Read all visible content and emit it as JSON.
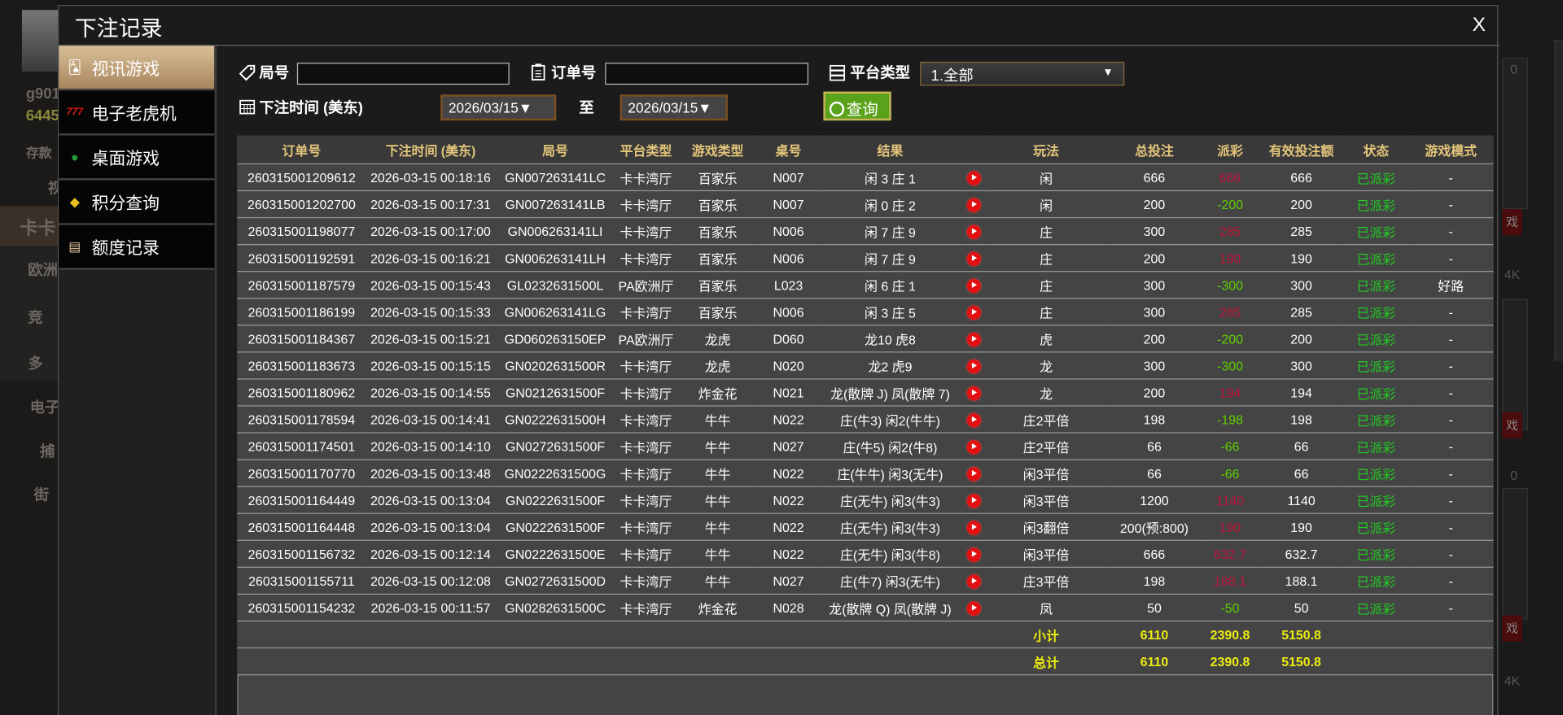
{
  "background": {
    "left_fragments": [
      "g901",
      "6445",
      "存款",
      "视",
      "卡卡",
      "欧洲",
      "竞",
      "多",
      "电子",
      "捕",
      "街"
    ],
    "right_fragments": [
      "0",
      "4K",
      "戏",
      "0",
      "4K"
    ]
  },
  "modal": {
    "title": "下注记录",
    "close_label": "X"
  },
  "menu": [
    {
      "label": "视讯游戏",
      "icon": "playing-cards-icon",
      "active": true
    },
    {
      "label": "电子老虎机",
      "icon": "slot-777-icon",
      "active": false
    },
    {
      "label": "桌面游戏",
      "icon": "chips-icon",
      "active": false
    },
    {
      "label": "积分查询",
      "icon": "diamond-icon",
      "active": false
    },
    {
      "label": "额度记录",
      "icon": "document-icon",
      "active": false
    }
  ],
  "filters": {
    "round_label": "局号",
    "round_value": "",
    "order_label": "订单号",
    "order_value": "",
    "platform_label": "平台类型",
    "platform_value": "1.全部",
    "time_label": "下注时间 (美东)",
    "date_from": "2026/03/15▼",
    "to_label": "至",
    "date_to": "2026/03/15▼",
    "query_label": "查询"
  },
  "colors": {
    "positive_payout": "#c0143c",
    "negative_payout": "#5fd000",
    "status": "#22cc22",
    "header": "#e2c47a",
    "totals": "#ecec10",
    "query_button": "#5aa21a"
  },
  "table": {
    "headers": [
      "订单号",
      "下注时间 (美东)",
      "局号",
      "平台类型",
      "游戏类型",
      "桌号",
      "结果",
      "",
      "玩法",
      "总投注",
      "派彩",
      "有效投注额",
      "状态",
      "游戏模式"
    ],
    "rows": [
      [
        "260315001209612",
        "2026-03-15 00:18:16",
        "GN007263141LC",
        "卡卡湾厅",
        "百家乐",
        "N007",
        "闲 3 庄 1",
        "闲",
        "666",
        "666",
        "666",
        "已派彩",
        "-"
      ],
      [
        "260315001202700",
        "2026-03-15 00:17:31",
        "GN007263141LB",
        "卡卡湾厅",
        "百家乐",
        "N007",
        "闲 0 庄 2",
        "闲",
        "200",
        "-200",
        "200",
        "已派彩",
        "-"
      ],
      [
        "260315001198077",
        "2026-03-15 00:17:00",
        "GN006263141LI",
        "卡卡湾厅",
        "百家乐",
        "N006",
        "闲 7 庄 9",
        "庄",
        "300",
        "285",
        "285",
        "已派彩",
        "-"
      ],
      [
        "260315001192591",
        "2026-03-15 00:16:21",
        "GN006263141LH",
        "卡卡湾厅",
        "百家乐",
        "N006",
        "闲 7 庄 9",
        "庄",
        "200",
        "190",
        "190",
        "已派彩",
        "-"
      ],
      [
        "260315001187579",
        "2026-03-15 00:15:43",
        "GL0232631500L",
        "PA欧洲厅",
        "百家乐",
        "L023",
        "闲 6 庄 1",
        "庄",
        "300",
        "-300",
        "300",
        "已派彩",
        "好路"
      ],
      [
        "260315001186199",
        "2026-03-15 00:15:33",
        "GN006263141LG",
        "卡卡湾厅",
        "百家乐",
        "N006",
        "闲 3 庄 5",
        "庄",
        "300",
        "285",
        "285",
        "已派彩",
        "-"
      ],
      [
        "260315001184367",
        "2026-03-15 00:15:21",
        "GD060263150EP",
        "PA欧洲厅",
        "龙虎",
        "D060",
        "龙10 虎8",
        "虎",
        "200",
        "-200",
        "200",
        "已派彩",
        "-"
      ],
      [
        "260315001183673",
        "2026-03-15 00:15:15",
        "GN0202631500R",
        "卡卡湾厅",
        "龙虎",
        "N020",
        "龙2 虎9",
        "龙",
        "300",
        "-300",
        "300",
        "已派彩",
        "-"
      ],
      [
        "260315001180962",
        "2026-03-15 00:14:55",
        "GN0212631500F",
        "卡卡湾厅",
        "炸金花",
        "N021",
        "龙(散牌 J) 凤(散牌 7)",
        "龙",
        "200",
        "194",
        "194",
        "已派彩",
        "-"
      ],
      [
        "260315001178594",
        "2026-03-15 00:14:41",
        "GN0222631500H",
        "卡卡湾厅",
        "牛牛",
        "N022",
        "庄(牛3) 闲2(牛牛)",
        "庄2平倍",
        "198",
        "-198",
        "198",
        "已派彩",
        "-"
      ],
      [
        "260315001174501",
        "2026-03-15 00:14:10",
        "GN0272631500F",
        "卡卡湾厅",
        "牛牛",
        "N027",
        "庄(牛5) 闲2(牛8)",
        "庄2平倍",
        "66",
        "-66",
        "66",
        "已派彩",
        "-"
      ],
      [
        "260315001170770",
        "2026-03-15 00:13:48",
        "GN0222631500G",
        "卡卡湾厅",
        "牛牛",
        "N022",
        "庄(牛牛) 闲3(无牛)",
        "闲3平倍",
        "66",
        "-66",
        "66",
        "已派彩",
        "-"
      ],
      [
        "260315001164449",
        "2026-03-15 00:13:04",
        "GN0222631500F",
        "卡卡湾厅",
        "牛牛",
        "N022",
        "庄(无牛) 闲3(牛3)",
        "闲3平倍",
        "1200",
        "1140",
        "1140",
        "已派彩",
        "-"
      ],
      [
        "260315001164448",
        "2026-03-15 00:13:04",
        "GN0222631500F",
        "卡卡湾厅",
        "牛牛",
        "N022",
        "庄(无牛) 闲3(牛3)",
        "闲3翻倍",
        "200(预:800)",
        "190",
        "190",
        "已派彩",
        "-"
      ],
      [
        "260315001156732",
        "2026-03-15 00:12:14",
        "GN0222631500E",
        "卡卡湾厅",
        "牛牛",
        "N022",
        "庄(无牛) 闲3(牛8)",
        "闲3平倍",
        "666",
        "632.7",
        "632.7",
        "已派彩",
        "-"
      ],
      [
        "260315001155711",
        "2026-03-15 00:12:08",
        "GN0272631500D",
        "卡卡湾厅",
        "牛牛",
        "N027",
        "庄(牛7) 闲3(无牛)",
        "庄3平倍",
        "198",
        "188.1",
        "188.1",
        "已派彩",
        "-"
      ],
      [
        "260315001154232",
        "2026-03-15 00:11:57",
        "GN0282631500C",
        "卡卡湾厅",
        "炸金花",
        "N028",
        "龙(散牌 Q) 凤(散牌 J)",
        "凤",
        "50",
        "-50",
        "50",
        "已派彩",
        "-"
      ]
    ],
    "subtotal": {
      "label": "小计",
      "total_bet": "6110",
      "payout": "2390.8",
      "valid_bet": "5150.8"
    },
    "total": {
      "label": "总计",
      "total_bet": "6110",
      "payout": "2390.8",
      "valid_bet": "5150.8"
    }
  }
}
